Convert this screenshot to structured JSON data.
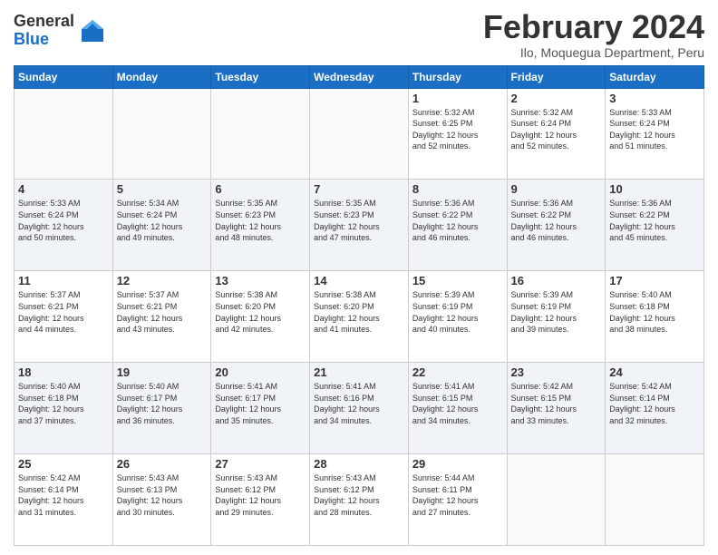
{
  "logo": {
    "general": "General",
    "blue": "Blue"
  },
  "header": {
    "month": "February 2024",
    "location": "Ilo, Moquegua Department, Peru"
  },
  "weekdays": [
    "Sunday",
    "Monday",
    "Tuesday",
    "Wednesday",
    "Thursday",
    "Friday",
    "Saturday"
  ],
  "weeks": [
    [
      {
        "day": "",
        "info": ""
      },
      {
        "day": "",
        "info": ""
      },
      {
        "day": "",
        "info": ""
      },
      {
        "day": "",
        "info": ""
      },
      {
        "day": "1",
        "info": "Sunrise: 5:32 AM\nSunset: 6:25 PM\nDaylight: 12 hours\nand 52 minutes."
      },
      {
        "day": "2",
        "info": "Sunrise: 5:32 AM\nSunset: 6:24 PM\nDaylight: 12 hours\nand 52 minutes."
      },
      {
        "day": "3",
        "info": "Sunrise: 5:33 AM\nSunset: 6:24 PM\nDaylight: 12 hours\nand 51 minutes."
      }
    ],
    [
      {
        "day": "4",
        "info": "Sunrise: 5:33 AM\nSunset: 6:24 PM\nDaylight: 12 hours\nand 50 minutes."
      },
      {
        "day": "5",
        "info": "Sunrise: 5:34 AM\nSunset: 6:24 PM\nDaylight: 12 hours\nand 49 minutes."
      },
      {
        "day": "6",
        "info": "Sunrise: 5:35 AM\nSunset: 6:23 PM\nDaylight: 12 hours\nand 48 minutes."
      },
      {
        "day": "7",
        "info": "Sunrise: 5:35 AM\nSunset: 6:23 PM\nDaylight: 12 hours\nand 47 minutes."
      },
      {
        "day": "8",
        "info": "Sunrise: 5:36 AM\nSunset: 6:22 PM\nDaylight: 12 hours\nand 46 minutes."
      },
      {
        "day": "9",
        "info": "Sunrise: 5:36 AM\nSunset: 6:22 PM\nDaylight: 12 hours\nand 46 minutes."
      },
      {
        "day": "10",
        "info": "Sunrise: 5:36 AM\nSunset: 6:22 PM\nDaylight: 12 hours\nand 45 minutes."
      }
    ],
    [
      {
        "day": "11",
        "info": "Sunrise: 5:37 AM\nSunset: 6:21 PM\nDaylight: 12 hours\nand 44 minutes."
      },
      {
        "day": "12",
        "info": "Sunrise: 5:37 AM\nSunset: 6:21 PM\nDaylight: 12 hours\nand 43 minutes."
      },
      {
        "day": "13",
        "info": "Sunrise: 5:38 AM\nSunset: 6:20 PM\nDaylight: 12 hours\nand 42 minutes."
      },
      {
        "day": "14",
        "info": "Sunrise: 5:38 AM\nSunset: 6:20 PM\nDaylight: 12 hours\nand 41 minutes."
      },
      {
        "day": "15",
        "info": "Sunrise: 5:39 AM\nSunset: 6:19 PM\nDaylight: 12 hours\nand 40 minutes."
      },
      {
        "day": "16",
        "info": "Sunrise: 5:39 AM\nSunset: 6:19 PM\nDaylight: 12 hours\nand 39 minutes."
      },
      {
        "day": "17",
        "info": "Sunrise: 5:40 AM\nSunset: 6:18 PM\nDaylight: 12 hours\nand 38 minutes."
      }
    ],
    [
      {
        "day": "18",
        "info": "Sunrise: 5:40 AM\nSunset: 6:18 PM\nDaylight: 12 hours\nand 37 minutes."
      },
      {
        "day": "19",
        "info": "Sunrise: 5:40 AM\nSunset: 6:17 PM\nDaylight: 12 hours\nand 36 minutes."
      },
      {
        "day": "20",
        "info": "Sunrise: 5:41 AM\nSunset: 6:17 PM\nDaylight: 12 hours\nand 35 minutes."
      },
      {
        "day": "21",
        "info": "Sunrise: 5:41 AM\nSunset: 6:16 PM\nDaylight: 12 hours\nand 34 minutes."
      },
      {
        "day": "22",
        "info": "Sunrise: 5:41 AM\nSunset: 6:15 PM\nDaylight: 12 hours\nand 34 minutes."
      },
      {
        "day": "23",
        "info": "Sunrise: 5:42 AM\nSunset: 6:15 PM\nDaylight: 12 hours\nand 33 minutes."
      },
      {
        "day": "24",
        "info": "Sunrise: 5:42 AM\nSunset: 6:14 PM\nDaylight: 12 hours\nand 32 minutes."
      }
    ],
    [
      {
        "day": "25",
        "info": "Sunrise: 5:42 AM\nSunset: 6:14 PM\nDaylight: 12 hours\nand 31 minutes."
      },
      {
        "day": "26",
        "info": "Sunrise: 5:43 AM\nSunset: 6:13 PM\nDaylight: 12 hours\nand 30 minutes."
      },
      {
        "day": "27",
        "info": "Sunrise: 5:43 AM\nSunset: 6:12 PM\nDaylight: 12 hours\nand 29 minutes."
      },
      {
        "day": "28",
        "info": "Sunrise: 5:43 AM\nSunset: 6:12 PM\nDaylight: 12 hours\nand 28 minutes."
      },
      {
        "day": "29",
        "info": "Sunrise: 5:44 AM\nSunset: 6:11 PM\nDaylight: 12 hours\nand 27 minutes."
      },
      {
        "day": "",
        "info": ""
      },
      {
        "day": "",
        "info": ""
      }
    ]
  ]
}
